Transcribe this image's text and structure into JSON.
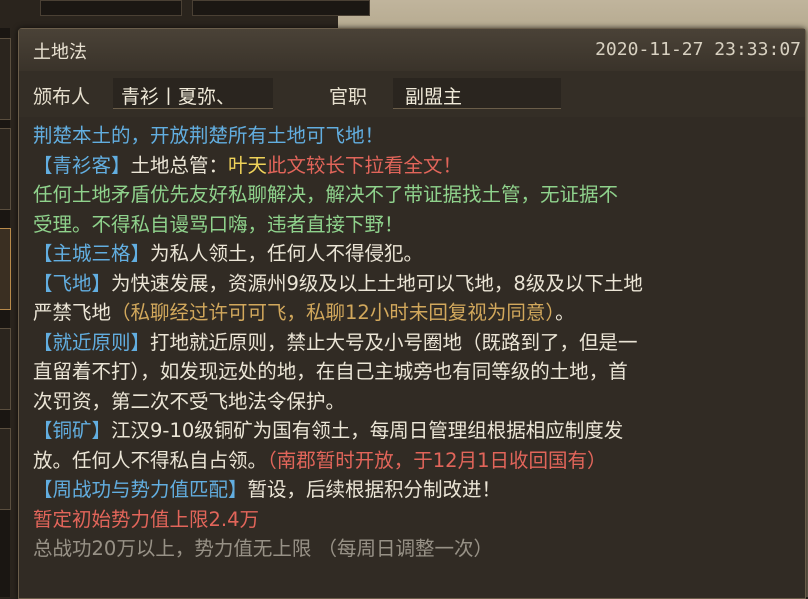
{
  "window": {
    "title": "土地法",
    "timestamp": "2020-11-27 23:33:07"
  },
  "meta": {
    "publisher_label": "颁布人",
    "publisher_value": "青衫丨夏弥、",
    "office_label": "官职",
    "office_value": "副盟主"
  },
  "announcement": {
    "l1": "荆楚本土的，开放荆楚所有土地可飞地！",
    "l2a": "【青衫客】",
    "l2b": "土地总管：",
    "l2c": "叶天",
    "l2d": "此文较长下拉看全文！",
    "l3": "  任何土地矛盾优先友好私聊解决，解决不了带证据找土管，无证据不",
    "l4": "受理。不得私自谩骂口嗨，违者直接下野！",
    "l5a": "【主城三格】",
    "l5b": "为私人领土，任何人不得侵犯。",
    "l6a": "【飞地】",
    "l6b": "为快速发展，资源州9级及以上土地可以飞地，8级及以下土地",
    "l7a": "严禁飞地",
    "l7b": "（私聊经过许可可飞，私聊12小时未回复视为同意）",
    "l7c": "。",
    "l8a": "【就近原则】",
    "l8b": "打地就近原则，禁止大号及小号圈地（既路到了，但是一",
    "l9": "直留着不打），如发现远处的地，在自己主城旁也有同等级的土地，首",
    "l10": "次罚资，第二次不受飞地法令保护。",
    "l11a": "【铜矿】",
    "l11b": "江汉9-10级铜矿为国有领土，每周日管理组根据相应制度发",
    "l12a": "放。任何人不得私自占领。",
    "l12b": "（南郡暂时开放，于12月1日收回国有）",
    "l13a": "【周战功与势力值匹配】",
    "l13b": "暂设，后续根据积分制改进！",
    "l14": "暂定初始势力值上限2.4万",
    "l15": "总战功20万以上，势力值无上限        （每周日调整一次）"
  }
}
